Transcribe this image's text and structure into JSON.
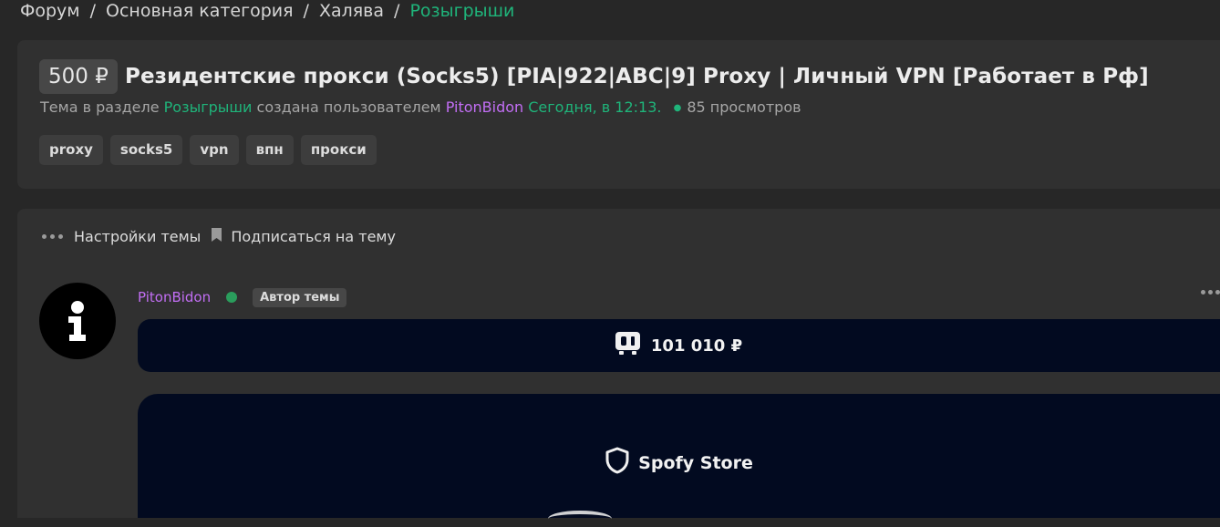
{
  "breadcrumb": {
    "items": [
      "Форум",
      "Основная категория",
      "Халява"
    ],
    "active": "Розыгрыши",
    "separator": "/"
  },
  "thread": {
    "price": "500 ₽",
    "title": "Резидентские прокси (Socks5) [PIA|922|ABC|9] Proxy | Личный VPN [Работает в Рф]",
    "meta": {
      "prefix": "Тема в разделе",
      "section": "Розыгрыши",
      "created_by": "создана пользователем",
      "author": "PitonBidon",
      "time": "Сегодня, в 12:13.",
      "views": "85 просмотров"
    },
    "tags": [
      "proxy",
      "socks5",
      "vpn",
      "впн",
      "прокси"
    ]
  },
  "actions": {
    "settings": "Настройки темы",
    "subscribe": "Подписаться на тему"
  },
  "post": {
    "author": "PitonBidon",
    "author_badge": "Автор темы",
    "balance": "101 010 ₽",
    "store_name": "Spofy Store"
  },
  "colors": {
    "accent_green": "#1fb47a",
    "author_purple": "#c26ef4",
    "online": "#2a9d5c",
    "banner_bg": "#020a20"
  },
  "icons": {
    "settings": "dots-icon",
    "subscribe": "bookmark-icon",
    "avatar": "info-icon",
    "balance": "wallet-icon",
    "store": "shield-icon"
  }
}
